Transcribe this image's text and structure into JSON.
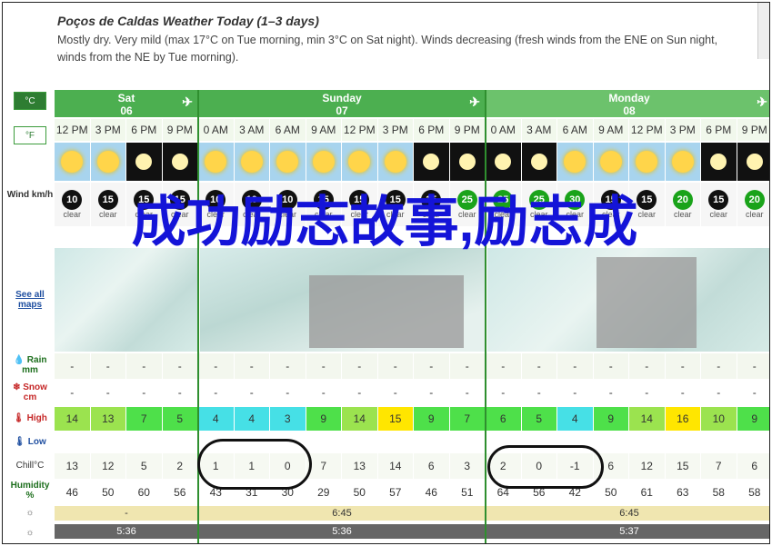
{
  "header": {
    "title": "Poços de Caldas Weather Today (1–3 days)",
    "desc_1": "Mostly dry. Very mild (max 17°C on Tue morning, min 3°C on Sat night). Winds decreasing (fresh winds from the ENE on Sun night,",
    "desc_2": "winds from the NE by Tue morning)."
  },
  "units": {
    "c": "°C",
    "f": "°F"
  },
  "labels": {
    "wind": "Wind km/h",
    "seeall": "See all maps",
    "rain": "Rain mm",
    "snow": "Snow cm",
    "high": "High",
    "low": "Low",
    "chill": "Chill°C",
    "humidity": "Humidity %"
  },
  "days": [
    {
      "name": "Sat",
      "num": "06"
    },
    {
      "name": "Sunday",
      "num": "07"
    },
    {
      "name": "Monday",
      "num": "08"
    }
  ],
  "times": [
    "12 PM",
    "3 PM",
    "6 PM",
    "9 PM",
    "0 AM",
    "3 AM",
    "6 AM",
    "9 AM",
    "12 PM",
    "3 PM",
    "6 PM",
    "9 PM",
    "0 AM",
    "3 AM",
    "6 AM",
    "9 AM",
    "12 PM",
    "3 PM",
    "6 PM",
    "9 PM"
  ],
  "wind": [
    "10",
    "15",
    "15",
    "15",
    "10",
    "10",
    "10",
    "15",
    "15",
    "15",
    "15",
    "25",
    "25",
    "25",
    "30",
    "15",
    "15",
    "20",
    "15",
    "20"
  ],
  "clouds": [
    "clear",
    "clear",
    "clear",
    "clear",
    "clear",
    "clear",
    "clear",
    "clear",
    "clear",
    "clear",
    "clear",
    "clear",
    "clear",
    "clear",
    "clear",
    "clear",
    "clear",
    "clear",
    "clear",
    "clear"
  ],
  "rain": [
    "-",
    "-",
    "-",
    "-",
    "-",
    "-",
    "-",
    "-",
    "-",
    "-",
    "-",
    "-",
    "-",
    "-",
    "-",
    "-",
    "-",
    "-",
    "-",
    "-"
  ],
  "snow": [
    "-",
    "-",
    "-",
    "-",
    "-",
    "-",
    "-",
    "-",
    "-",
    "-",
    "-",
    "-",
    "-",
    "-",
    "-",
    "-",
    "-",
    "-",
    "-",
    "-"
  ],
  "high": [
    "14",
    "13",
    "7",
    "5",
    "4",
    "4",
    "3",
    "9",
    "14",
    "15",
    "9",
    "7",
    "6",
    "5",
    "4",
    "9",
    "14",
    "16",
    "10",
    "9"
  ],
  "high_colors": [
    "#9be34f",
    "#9be34f",
    "#4ee04a",
    "#4ee04a",
    "#46e0e6",
    "#46e0e6",
    "#46e0e6",
    "#4ee04a",
    "#9be34f",
    "#ffe600",
    "#4ee04a",
    "#4ee04a",
    "#4ee04a",
    "#4ee04a",
    "#46e0e6",
    "#4ee04a",
    "#9be34f",
    "#ffe600",
    "#9be34f",
    "#4ee04a"
  ],
  "chill": [
    "13",
    "12",
    "5",
    "2",
    "1",
    "1",
    "0",
    "7",
    "13",
    "14",
    "6",
    "3",
    "2",
    "0",
    "-1",
    "6",
    "12",
    "15",
    "7",
    "6"
  ],
  "humidity": [
    "46",
    "50",
    "60",
    "56",
    "43",
    "31",
    "30",
    "29",
    "50",
    "57",
    "46",
    "51",
    "64",
    "56",
    "42",
    "50",
    "61",
    "63",
    "58",
    "58"
  ],
  "sunrise": {
    "sun_sat": "-",
    "sun_sun": "6:45",
    "sun_mon": "6:45"
  },
  "sunset": {
    "sat": "5:36",
    "sun": "5:36",
    "mon": "5:37"
  },
  "dash": "-",
  "overlay": "成功励志故事,励志成"
}
